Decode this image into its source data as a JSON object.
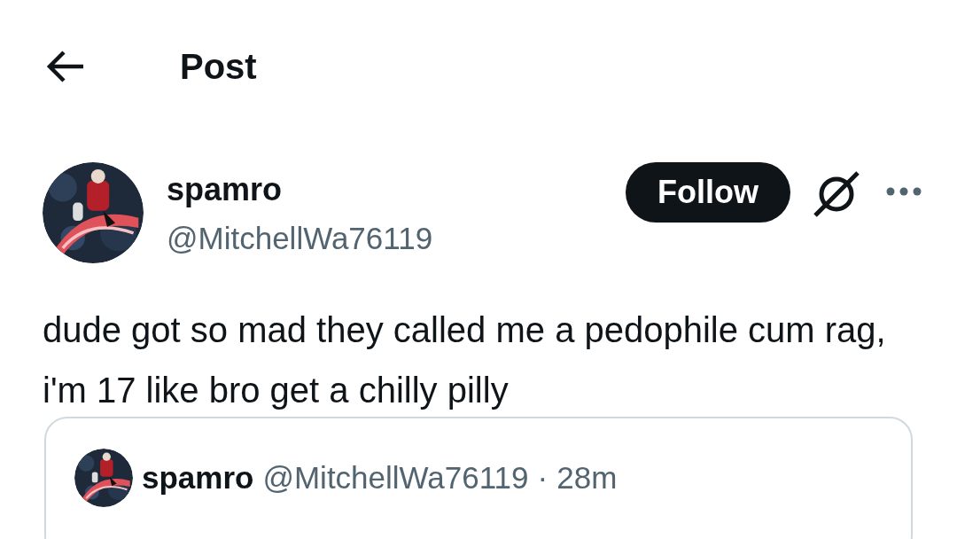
{
  "header": {
    "title": "Post"
  },
  "author": {
    "name": "spamro",
    "handle": "@MitchellWa76119",
    "follow_button": "Follow"
  },
  "text": "dude got so mad they called me a pedophile cum rag, i'm 17 like bro get a chilly pilly",
  "quoted_post": {
    "name": "spamro",
    "handle": "@MitchellWa76119",
    "separator": "·",
    "time": "28m"
  }
}
